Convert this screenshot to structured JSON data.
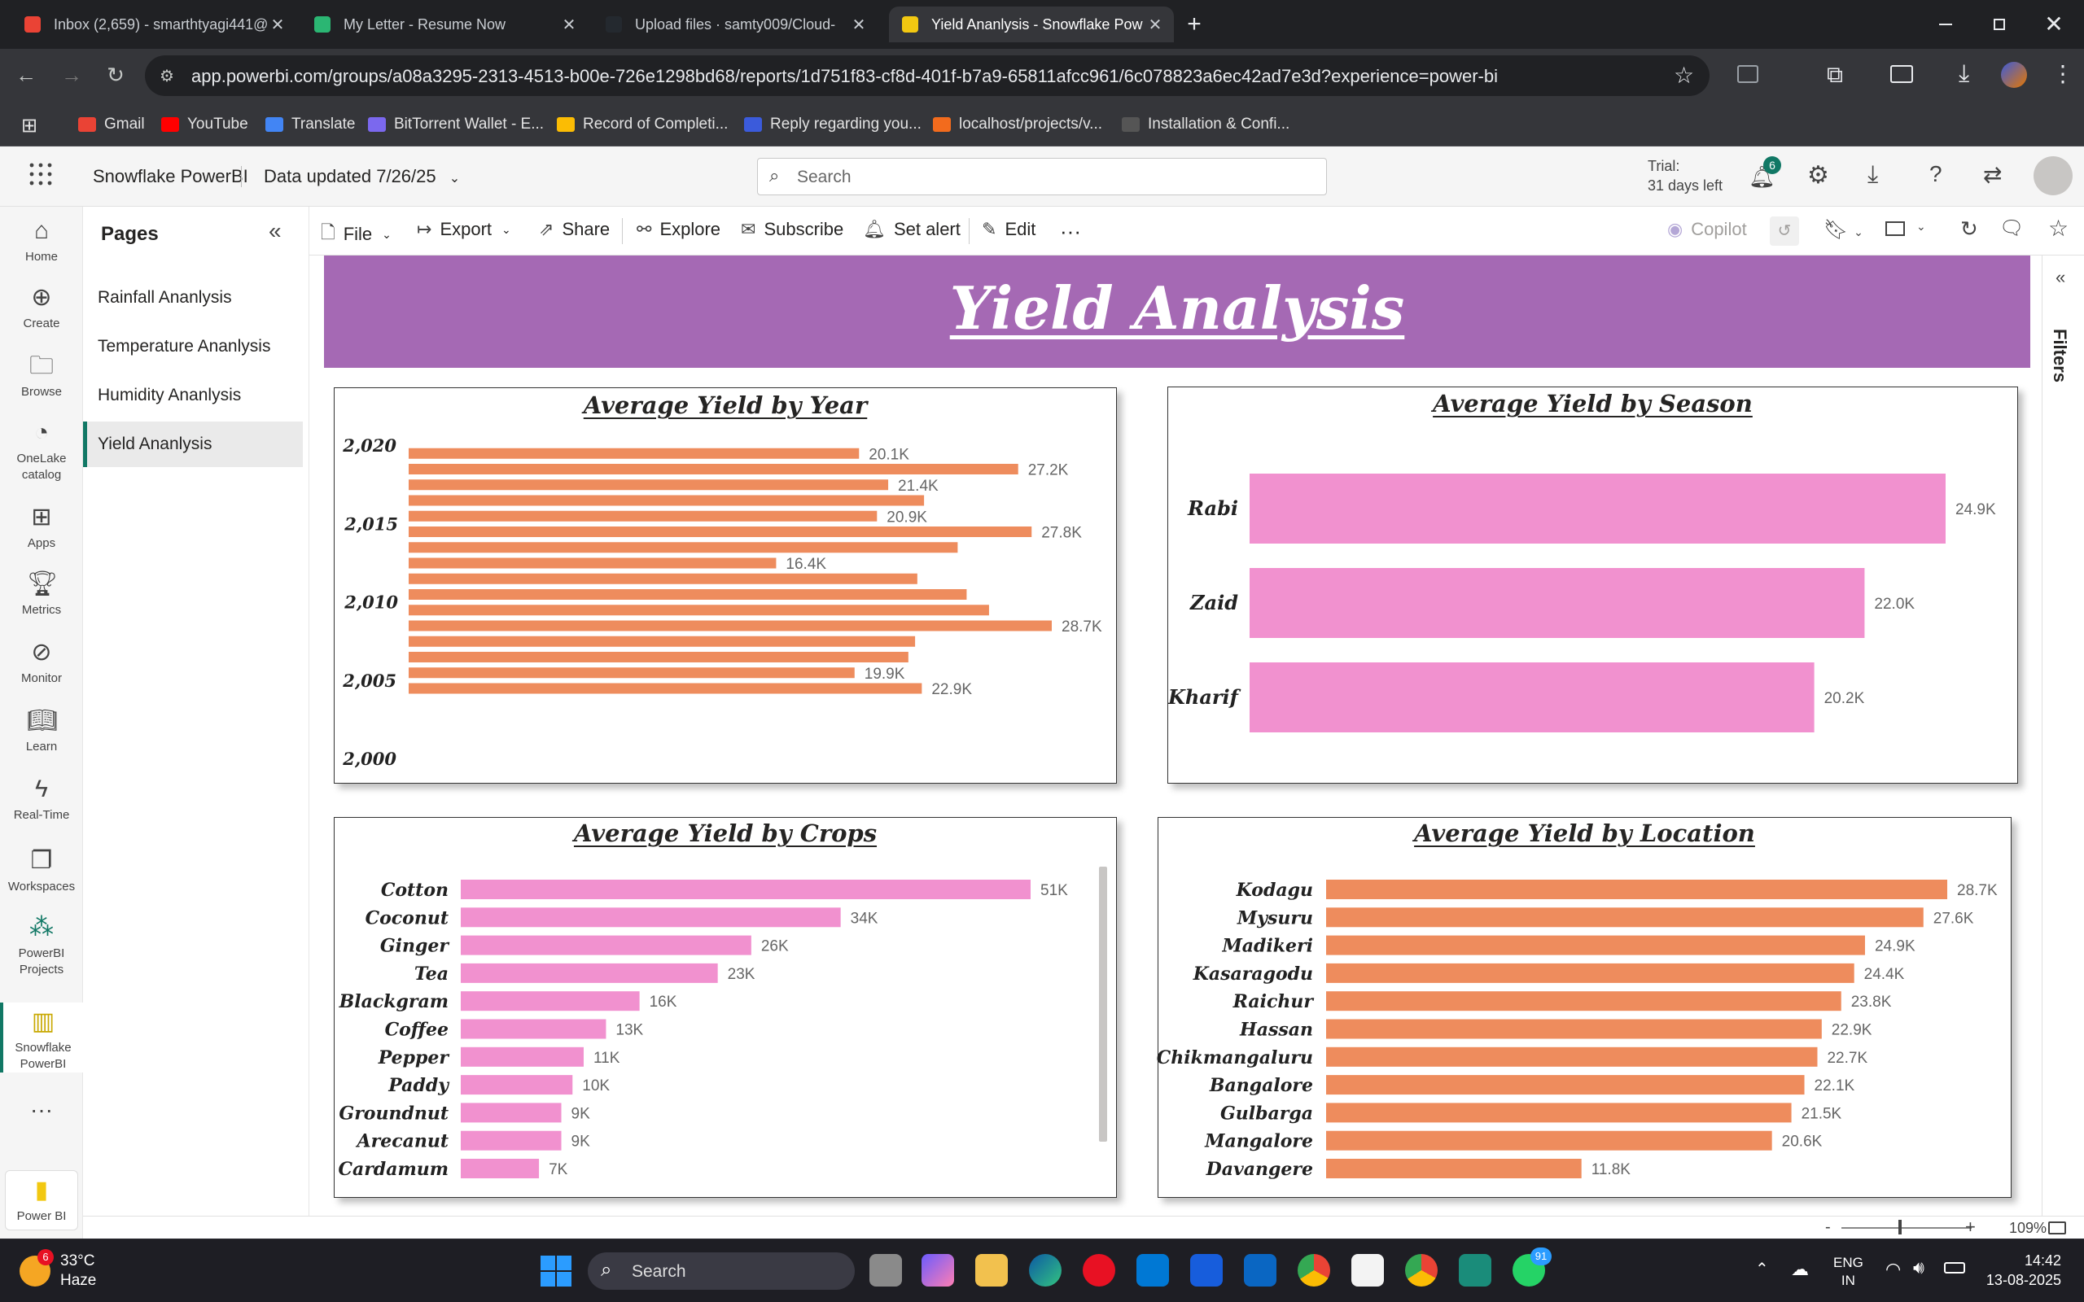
{
  "browser": {
    "tabs": [
      {
        "title": "Inbox (2,659) - smarthtyagi441@",
        "favicon_color": "#ea4335",
        "active": false
      },
      {
        "title": "My Letter - Resume Now",
        "favicon_color": "#2bb673",
        "active": false
      },
      {
        "title": "Upload files · samty009/Cloud-",
        "favicon_color": "#24292f",
        "active": false
      },
      {
        "title": "Yield Ananlysis - Snowflake Pow",
        "favicon_color": "#f2c811",
        "active": true
      }
    ],
    "new_tab": "+",
    "url": "app.powerbi.com/groups/a08a3295-2313-4513-b00e-726e1298bd68/reports/1d751f83-cf8d-401f-b7a9-65811afcc961/6c078823a6ec42ad7e3d?experience=power-bi",
    "bookmarks": [
      {
        "label": "Gmail",
        "color": "#ea4335"
      },
      {
        "label": "YouTube",
        "color": "#ff0000"
      },
      {
        "label": "Translate",
        "color": "#4285f4"
      },
      {
        "label": "BitTorrent Wallet - E...",
        "color": "#7b68ee"
      },
      {
        "label": "Record of Completi...",
        "color": "#fbbc04"
      },
      {
        "label": "Reply regarding you...",
        "color": "#3b5bdb"
      },
      {
        "label": "localhost/projects/v...",
        "color": "#f26b1d"
      },
      {
        "label": "Installation & Confi...",
        "color": "#555555"
      }
    ]
  },
  "pbi_header": {
    "app_name": "Snowflake PowerBI",
    "data_updated": "Data updated 7/26/25",
    "search_placeholder": "Search",
    "trial_line1": "Trial:",
    "trial_line2": "31 days left",
    "notification_count": "6"
  },
  "left_nav": [
    {
      "label": "Home",
      "icon": "home-icon"
    },
    {
      "label": "Create",
      "icon": "create-icon"
    },
    {
      "label": "Browse",
      "icon": "folder-icon"
    },
    {
      "label": "OneLake catalog",
      "icon": "onelake-icon"
    },
    {
      "label": "Apps",
      "icon": "apps-icon"
    },
    {
      "label": "Metrics",
      "icon": "trophy-icon"
    },
    {
      "label": "Monitor",
      "icon": "monitor-icon"
    },
    {
      "label": "Learn",
      "icon": "book-icon"
    },
    {
      "label": "Real-Time",
      "icon": "lightning-icon"
    },
    {
      "label": "Workspaces",
      "icon": "workspaces-icon"
    },
    {
      "label": "PowerBI Projects",
      "icon": "projects-icon"
    },
    {
      "label": "Snowflake PowerBI",
      "icon": "report-icon"
    },
    {
      "label": "Power BI",
      "icon": "powerbi-logo-icon"
    }
  ],
  "pages_pane": {
    "title": "Pages",
    "pages": [
      "Rainfall Ananlysis",
      "Temperature Ananlysis",
      "Humidity Ananlysis",
      "Yield Ananlysis"
    ],
    "selected": "Yield Ananlysis"
  },
  "actions": {
    "file": "File",
    "export": "Export",
    "share": "Share",
    "explore": "Explore",
    "subscribe": "Subscribe",
    "set_alert": "Set alert",
    "edit": "Edit",
    "more": "···",
    "copilot": "Copilot"
  },
  "report": {
    "banner_title": "Yield Analysis",
    "filters_label": "Filters"
  },
  "colors": {
    "banner": "#a569b4",
    "orange_bar": "#ee8c5d",
    "pink_bar": "#f191cf",
    "selected_page_accent": "#117865"
  },
  "chart_data": [
    {
      "type": "bar",
      "orientation": "horizontal",
      "title": "Average Yield by Year",
      "y_axis_ticks": [
        "2,020",
        "2,015",
        "2,010",
        "2,005",
        "2,000"
      ],
      "ylim": [
        2000,
        2020
      ],
      "x": [
        2019,
        2018,
        2017,
        2016,
        2015,
        2014,
        2013,
        2012,
        2011,
        2010,
        2009,
        2008,
        2007,
        2006,
        2005,
        2004
      ],
      "values": [
        20100,
        27200,
        21400,
        23000,
        20900,
        27800,
        24500,
        16400,
        22700,
        24900,
        25900,
        28700,
        22600,
        22300,
        19900,
        22900
      ],
      "data_labels": [
        "20.1K",
        "27.2K",
        "21.4K",
        "",
        "20.9K",
        "27.8K",
        "",
        "16.4K",
        "",
        "",
        "",
        "28.7K",
        "",
        "",
        "19.9K",
        "22.9K"
      ],
      "color": "#ee8c5d"
    },
    {
      "type": "bar",
      "orientation": "horizontal",
      "title": "Average Yield by Season",
      "categories": [
        "Rabi",
        "Zaid",
        "Kharif"
      ],
      "values": [
        24900,
        22000,
        20200
      ],
      "data_labels": [
        "24.9K",
        "22.0K",
        "20.2K"
      ],
      "color": "#f191cf"
    },
    {
      "type": "bar",
      "orientation": "horizontal",
      "title": "Average Yield by Crops",
      "categories": [
        "Cotton",
        "Coconut",
        "Ginger",
        "Tea",
        "Blackgram",
        "Coffee",
        "Pepper",
        "Paddy",
        "Groundnut",
        "Arecanut",
        "Cardamum"
      ],
      "values": [
        51000,
        34000,
        26000,
        23000,
        16000,
        13000,
        11000,
        10000,
        9000,
        9000,
        7000
      ],
      "data_labels": [
        "51K",
        "34K",
        "26K",
        "23K",
        "16K",
        "13K",
        "11K",
        "10K",
        "9K",
        "9K",
        "7K"
      ],
      "color": "#f191cf"
    },
    {
      "type": "bar",
      "orientation": "horizontal",
      "title": "Average Yield by Location",
      "categories": [
        "Kodagu",
        "Mysuru",
        "Madikeri",
        "Kasaragodu",
        "Raichur",
        "Hassan",
        "Chikmangaluru",
        "Bangalore",
        "Gulbarga",
        "Mangalore",
        "Davangere"
      ],
      "values": [
        28700,
        27600,
        24900,
        24400,
        23800,
        22900,
        22700,
        22100,
        21500,
        20600,
        11800
      ],
      "data_labels": [
        "28.7K",
        "27.6K",
        "24.9K",
        "24.4K",
        "23.8K",
        "22.9K",
        "22.7K",
        "22.1K",
        "21.5K",
        "20.6K",
        "11.8K"
      ],
      "color": "#ee8c5d"
    }
  ],
  "status_bar": {
    "zoom_minus": "-",
    "zoom_plus": "+",
    "zoom": "109%"
  },
  "taskbar": {
    "weather_temp": "33°C",
    "weather_desc": "Haze",
    "weather_badge": "6",
    "search_label": "Search",
    "whatsapp_badge": "91",
    "lang_line1": "ENG",
    "lang_line2": "IN",
    "time": "14:42",
    "date": "13-08-2025"
  }
}
